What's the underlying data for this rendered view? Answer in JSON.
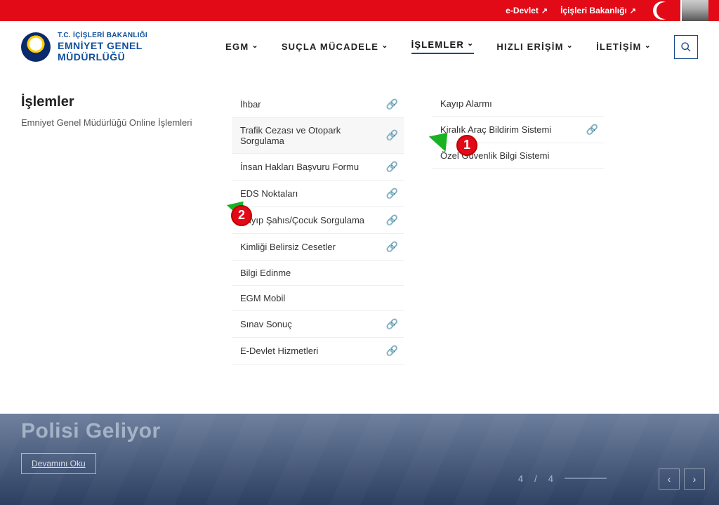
{
  "topbar": {
    "edevlet": "e-Devlet",
    "ministry": "İçişleri Bakanlığı"
  },
  "brand": {
    "line1": "T.C. İÇİŞLERİ BAKANLIĞI",
    "line2": "EMNİYET GENEL",
    "line3": "MÜDÜRLÜĞÜ"
  },
  "nav": {
    "egm": "EGM",
    "sucla": "SUÇLA MÜCADELE",
    "islemler": "İŞLEMLER",
    "hizli": "HIZLI ERİŞİM",
    "iletisim": "İLETİŞİM"
  },
  "mega": {
    "title": "İşlemler",
    "subtitle": "Emniyet Genel Müdürlüğü Online İşlemleri",
    "col1": [
      {
        "label": "İhbar",
        "ext": true
      },
      {
        "label": "Trafik Cezası ve Otopark Sorgulama",
        "ext": true,
        "hl": true
      },
      {
        "label": "İnsan Hakları Başvuru Formu",
        "ext": true
      },
      {
        "label": "EDS Noktaları",
        "ext": true
      },
      {
        "label": "Kayıp Şahıs/Çocuk Sorgulama",
        "ext": true
      },
      {
        "label": "Kimliği Belirsiz Cesetler",
        "ext": true
      },
      {
        "label": "Bilgi Edinme",
        "ext": false
      },
      {
        "label": "EGM Mobil",
        "ext": false
      },
      {
        "label": "Sınav Sonuç",
        "ext": true
      },
      {
        "label": "E-Devlet Hizmetleri",
        "ext": true
      }
    ],
    "col2": [
      {
        "label": "Kayıp Alarmı",
        "ext": false
      },
      {
        "label": "Kiralık Araç Bildirim Sistemi",
        "ext": true
      },
      {
        "label": "Özel Güvenlik Bilgi Sistemi",
        "ext": false
      }
    ]
  },
  "annotations": {
    "b1": "1",
    "b2": "2"
  },
  "hero": {
    "title": "Polisi Geliyor",
    "read": "Devamını Oku",
    "page_current": "4",
    "page_sep": " / ",
    "page_total": "4"
  }
}
